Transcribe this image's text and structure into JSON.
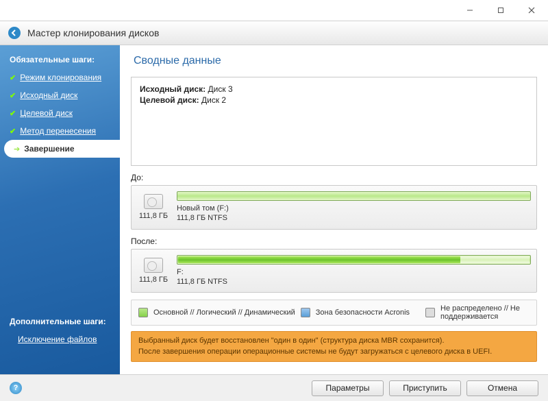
{
  "window": {
    "title": "Мастер клонирования дисков"
  },
  "sidebar": {
    "required_heading": "Обязательные шаги:",
    "items": [
      {
        "label": "Режим клонирования",
        "done": true
      },
      {
        "label": "Исходный диск",
        "done": true
      },
      {
        "label": "Целевой диск",
        "done": true
      },
      {
        "label": "Метод перенесения",
        "done": true
      },
      {
        "label": "Завершение",
        "active": true
      }
    ],
    "extra_heading": "Дополнительные шаги:",
    "extra_items": [
      {
        "label": "Исключение файлов"
      }
    ]
  },
  "main": {
    "title": "Сводные данные",
    "summary": {
      "source_label": "Исходный диск:",
      "source_value": "Диск 3",
      "target_label": "Целевой диск:",
      "target_value": "Диск 2"
    },
    "before": {
      "heading": "До:",
      "size": "111,8 ГБ",
      "vol_name": "Новый том (F:)",
      "vol_detail": "111,8 ГБ  NTFS"
    },
    "after": {
      "heading": "После:",
      "size": "111,8 ГБ",
      "vol_name": "F:",
      "vol_detail": "111,8 ГБ  NTFS"
    },
    "legend": {
      "primary": "Основной // Логический // Динамический",
      "zone": "Зона безопасности Acronis",
      "unalloc": "Не распределено // Не поддерживается"
    },
    "warning": {
      "line1": "Выбранный диск будет восстановлен \"один в один\" (структура диска MBR сохранится).",
      "line2": "После завершения операции операционные системы не будут загружаться с целевого диска в UEFI."
    }
  },
  "footer": {
    "params": "Параметры",
    "proceed": "Приступить",
    "cancel": "Отмена"
  }
}
